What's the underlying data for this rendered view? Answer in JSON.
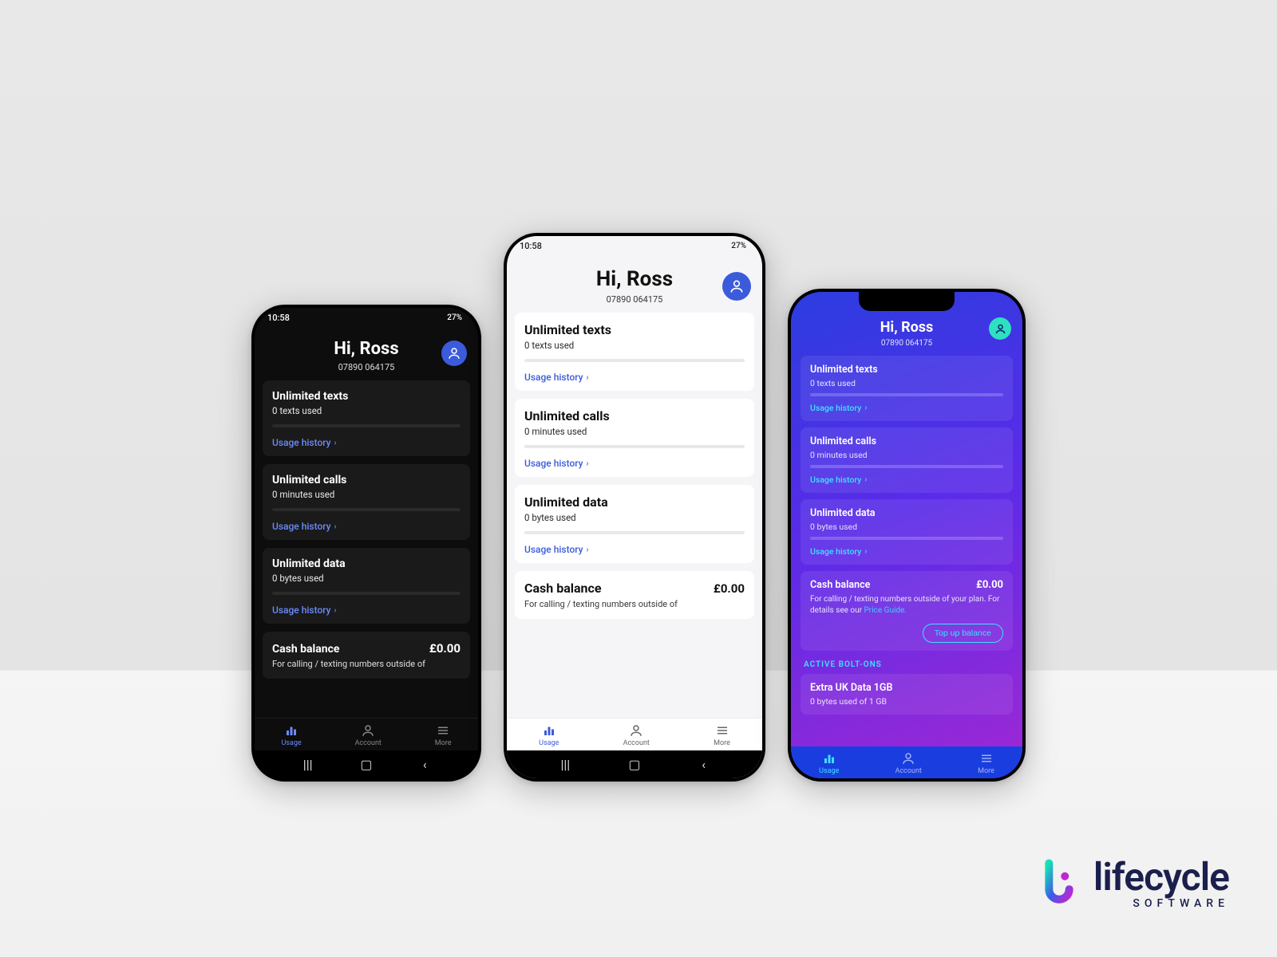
{
  "status": {
    "time": "10:58",
    "battery": "27%"
  },
  "header": {
    "greeting": "Hi, Ross",
    "phone_number": "07890 064175"
  },
  "cards": {
    "texts": {
      "title": "Unlimited texts",
      "sub": "0 texts used",
      "link": "Usage history"
    },
    "calls": {
      "title": "Unlimited calls",
      "sub": "0 minutes used",
      "link": "Usage history"
    },
    "data": {
      "title": "Unlimited data",
      "sub": "0 bytes used",
      "link": "Usage history"
    }
  },
  "balance": {
    "title": "Cash balance",
    "amount": "£0.00",
    "desc_short": "For calling / texting numbers outside of",
    "desc_full": "For calling / texting numbers outside of your plan. For details see our ",
    "price_guide": "Price Guide.",
    "topup": "Top up balance"
  },
  "boltons": {
    "label": "ACTIVE BOLT-ONS",
    "item_title": "Extra UK Data 1GB",
    "item_sub": "0 bytes used of 1 GB"
  },
  "tabs": {
    "usage": "Usage",
    "account": "Account",
    "more": "More"
  },
  "brand": {
    "name": "lifecycle",
    "tag": "SOFTWARE"
  }
}
